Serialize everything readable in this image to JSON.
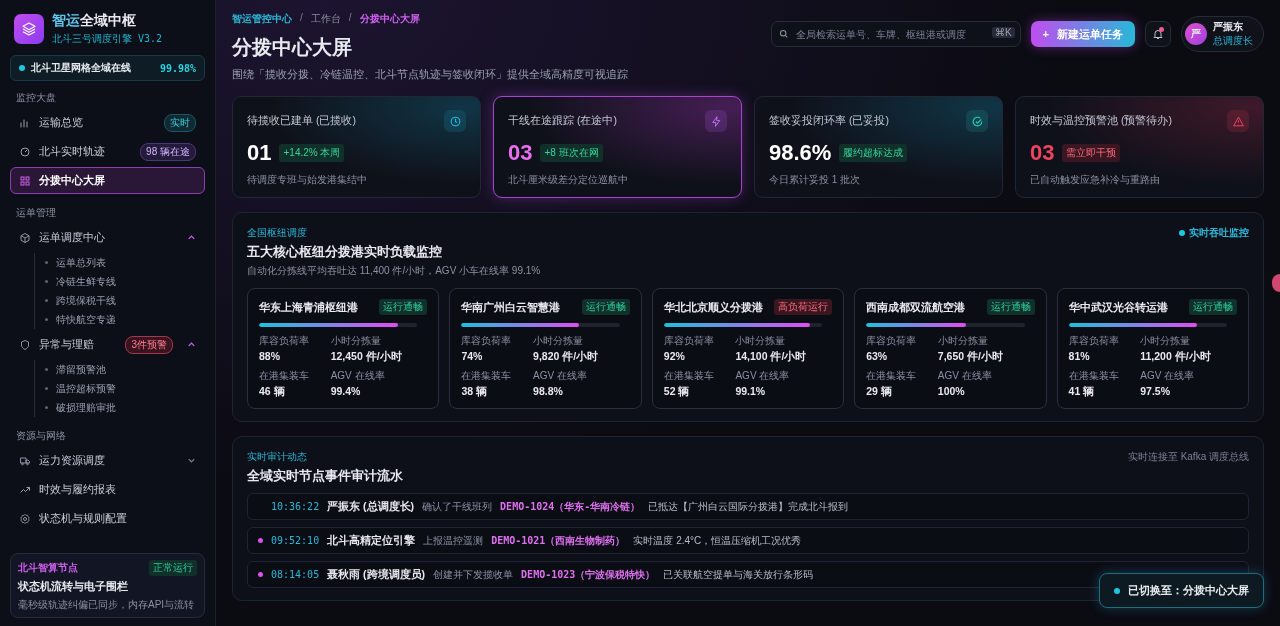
{
  "brand": {
    "title_accent": "智运",
    "title_rest": "全域中枢",
    "subtitle": "北斗三号调度引擎 V3.2"
  },
  "network_status": {
    "label": "北斗卫星网格全域在线",
    "value": "99.98%"
  },
  "nav_groups": [
    {
      "title": "监控大盘",
      "items": [
        {
          "label": "运输总览",
          "selected": false,
          "badge": {
            "text": "实时",
            "kind": "cyan"
          }
        },
        {
          "label": "北斗实时轨迹",
          "selected": false,
          "badge": {
            "text": "98 辆在途",
            "kind": "purple"
          }
        },
        {
          "label": "分拨中心大屏",
          "selected": true
        }
      ]
    },
    {
      "title": "运单管理",
      "items": [
        {
          "label": "运单调度中心",
          "selected": false,
          "expanded": true,
          "children": [
            {
              "label": "运单总列表"
            },
            {
              "label": "冷链生鲜专线"
            },
            {
              "label": "跨境保税干线"
            },
            {
              "label": "特快航空专递"
            }
          ]
        },
        {
          "label": "异常与理赔",
          "selected": false,
          "expanded": true,
          "badge": {
            "text": "3件预警",
            "kind": "red"
          },
          "children": [
            {
              "label": "滞留预警池"
            },
            {
              "label": "温控超标预警"
            },
            {
              "label": "破损理赔审批"
            }
          ]
        }
      ]
    },
    {
      "title": "资源与网络",
      "items": [
        {
          "label": "运力资源调度",
          "selected": false,
          "expanded": false
        },
        {
          "label": "时效与履约报表",
          "selected": false
        },
        {
          "label": "状态机与规则配置",
          "selected": false
        }
      ]
    }
  ],
  "node_card": {
    "title": "北斗智算节点",
    "status": "正常运行",
    "heading": "状态机流转与电子围栏",
    "text": "毫秒级轨迹纠偏已同步，内存API与流转"
  },
  "breadcrumb": [
    {
      "label": "智运管控中心",
      "selected": false
    },
    {
      "separator": "/",
      "label": "工作台",
      "selected": false
    },
    {
      "separator": "/",
      "label": "分拨中心大屏",
      "selected": true
    }
  ],
  "page_title": "分拨中心大屏",
  "page_subtitle": "围绕「揽收分拨、冷链温控、北斗节点轨迹与签收闭环」提供全域高精度可视追踪",
  "search": {
    "placeholder": "全局检索运单号、车牌、枢纽港或调度",
    "shortcut": "⌘K"
  },
  "new_button": {
    "icon": "+",
    "label": "新建运单任务"
  },
  "notifications": {
    "unread": true
  },
  "user": {
    "initial": "严",
    "name": "严振东",
    "role": "总调度长"
  },
  "kpis": [
    {
      "title": "待揽收已建单 (已揽收)",
      "value": "01",
      "badge": "+14.2% 本周",
      "note": "待调度专班与始发港集结中",
      "kind": "cyan",
      "selected": false
    },
    {
      "title": "干线在途跟踪 (在途中)",
      "value": "03",
      "badge": "+8 班次在网",
      "note": "北斗厘米级差分定位巡航中",
      "kind": "purple",
      "selected": true
    },
    {
      "title": "签收妥投闭环率 (已妥投)",
      "value": "98.6%",
      "badge": "履约超标达成",
      "note": "今日累计妥投 1 批次",
      "kind": "teal",
      "selected": false
    },
    {
      "title": "时效与温控预警池 (预警待办)",
      "value": "03",
      "badge": "需立即干预",
      "note": "已自动触发应急补冷与重路由",
      "kind": "red",
      "selected": false
    }
  ],
  "hubs_panel": {
    "eyebrow": "全国枢纽调度",
    "title": "五大核心枢纽分拨港实时负载监控",
    "subtitle": "自动化分拣线平均吞吐达 11,400 件/小时，AGV 小车在线率 99.1%",
    "live_label": "实时吞吐监控"
  },
  "hubs": [
    {
      "name": "华东上海青浦枢纽港",
      "status": "运行通畅",
      "kind": "ok",
      "level": 0.88,
      "stats": [
        {
          "label": "库容负荷率",
          "value": "88%"
        },
        {
          "label": "小时分拣量",
          "value": "12,450 件/小时"
        },
        {
          "label": "在港集装车",
          "value": "46 辆"
        },
        {
          "label": "AGV 在线率",
          "value": "99.4%"
        }
      ]
    },
    {
      "name": "华南广州白云智慧港",
      "status": "运行通畅",
      "kind": "ok",
      "level": 0.74,
      "stats": [
        {
          "label": "库容负荷率",
          "value": "74%"
        },
        {
          "label": "小时分拣量",
          "value": "9,820 件/小时"
        },
        {
          "label": "在港集装车",
          "value": "38 辆"
        },
        {
          "label": "AGV 在线率",
          "value": "98.8%"
        }
      ]
    },
    {
      "name": "华北北京顺义分拨港",
      "status": "高负荷运行",
      "kind": "high",
      "level": 0.92,
      "stats": [
        {
          "label": "库容负荷率",
          "value": "92%"
        },
        {
          "label": "小时分拣量",
          "value": "14,100 件/小时"
        },
        {
          "label": "在港集装车",
          "value": "52 辆"
        },
        {
          "label": "AGV 在线率",
          "value": "99.1%"
        }
      ]
    },
    {
      "name": "西南成都双流航空港",
      "status": "运行通畅",
      "kind": "ok",
      "level": 0.63,
      "stats": [
        {
          "label": "库容负荷率",
          "value": "63%"
        },
        {
          "label": "小时分拣量",
          "value": "7,650 件/小时"
        },
        {
          "label": "在港集装车",
          "value": "29 辆"
        },
        {
          "label": "AGV 在线率",
          "value": "100%"
        }
      ]
    },
    {
      "name": "华中武汉光谷转运港",
      "status": "运行通畅",
      "kind": "ok",
      "level": 0.81,
      "stats": [
        {
          "label": "库容负荷率",
          "value": "81%"
        },
        {
          "label": "小时分拣量",
          "value": "11,200 件/小时"
        },
        {
          "label": "在港集装车",
          "value": "41 辆"
        },
        {
          "label": "AGV 在线率",
          "value": "97.5%"
        }
      ]
    }
  ],
  "events_panel": {
    "eyebrow": "实时审计动态",
    "title": "全域实时节点事件审计流水",
    "connection": "实时连接至 Kafka 调度总线"
  },
  "events": [
    {
      "unread": false,
      "time": "10:36:22",
      "actor": "严振东 (总调度长)",
      "action": "确认了干线班列",
      "code": "DEMO-1024（华东-华南冷链）",
      "result": "已抵达【广州白云国际分拨港】完成北斗报到"
    },
    {
      "unread": true,
      "time": "09:52:10",
      "actor": "北斗高精定位引擎",
      "action": "上报温控遥测",
      "code": "DEMO-1021（西南生物制药）",
      "result": "实时温度 2.4°C，恒温压缩机工况优秀"
    },
    {
      "unread": true,
      "time": "08:14:05",
      "actor": "聂秋雨 (跨境调度员)",
      "action": "创建并下发揽收单",
      "code": "DEMO-1023（宁波保税特快）",
      "result": "已关联航空提单与海关放行条形码"
    }
  ],
  "toast": {
    "text": "已切换至：分拨中心大屏"
  }
}
